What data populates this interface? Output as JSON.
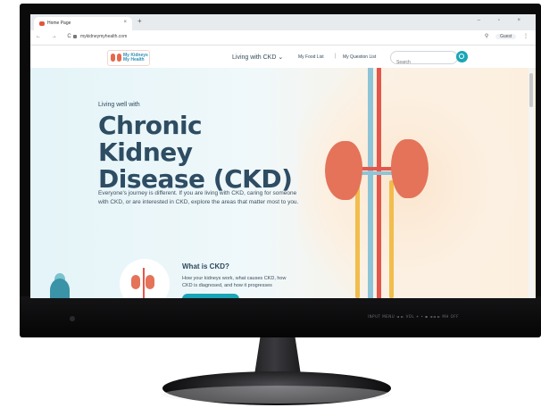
{
  "browser": {
    "tab_title": "Home Page",
    "tab_close": "×",
    "new_tab": "+",
    "window_controls": "–  ▫  ×",
    "nav_buttons": "← → C",
    "url": "mykidneymyhealth.com",
    "user_label": "Guest",
    "right_icons": "⚲",
    "menu_icon": "⋮"
  },
  "site": {
    "logo_text_line1": "My Kidneys",
    "logo_text_line2": "My Health",
    "nav_living": "Living with CKD ⌄",
    "nav_food": "My Food List",
    "nav_separator": "|",
    "nav_questions": "My Question List",
    "search_placeholder": "Search"
  },
  "hero": {
    "kicker": "Living well with",
    "title": "Chronic Kidney Disease (CKD)",
    "body": "Everyone's journey is different. If you are living with CKD, caring for someone with CKD, or are interested in CKD, explore the areas that matter most to you."
  },
  "card": {
    "title": "What is CKD?",
    "body": "How your kidneys work, what causes CKD, how CKD is diagnosed, and how it progresses"
  },
  "monitor": {
    "controls": "INPUT   MENU   ◄   ►   VOL +   •   ▪   ◄◄   ►   MH   OFF"
  }
}
